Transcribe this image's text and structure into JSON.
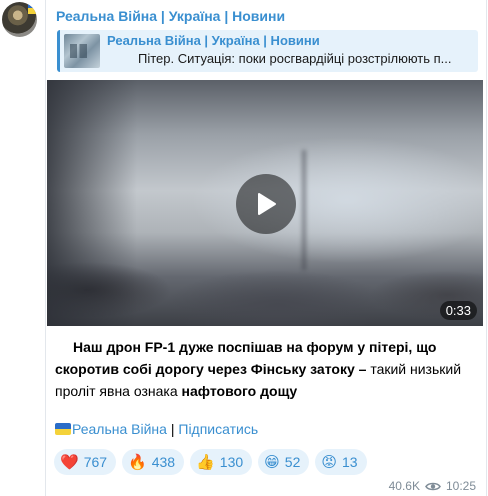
{
  "channel": {
    "name": "Реальна Війна | Україна | Новини"
  },
  "reply": {
    "name": "Реальна Війна | Україна | Новини",
    "text": "Пітер. Ситуація: поки росгвардійці розстрілюють п..."
  },
  "video": {
    "duration": "0:33"
  },
  "message": {
    "parts": [
      {
        "text": "Наш дрон FP-1 дуже поспішав на форум у пітері, що скоротив собі дорогу через Фінську затоку – ",
        "bold": true
      },
      {
        "text": "такий низький проліт явна ознака ",
        "bold": false
      },
      {
        "text": "нафтового дощу",
        "bold": true
      }
    ]
  },
  "footer": {
    "link_label": "Реальна Війна",
    "separator": " | ",
    "subscribe_label": "Підписатись"
  },
  "reactions": [
    {
      "emoji": "❤️",
      "count": "767",
      "icon": "heart-icon"
    },
    {
      "emoji": "🔥",
      "count": "438",
      "icon": "fire-icon"
    },
    {
      "emoji": "👍",
      "count": "130",
      "icon": "thumbs-up-icon"
    },
    {
      "emoji": "😁",
      "count": "52",
      "icon": "grin-icon"
    },
    {
      "emoji": "😡",
      "count": "13",
      "icon": "angry-face-icon"
    }
  ],
  "meta": {
    "views": "40.6K",
    "time": "10:25"
  },
  "colors": {
    "accent": "#3a8fd0",
    "reply_bg": "#e6f2fb",
    "meta": "#7f8c97"
  }
}
